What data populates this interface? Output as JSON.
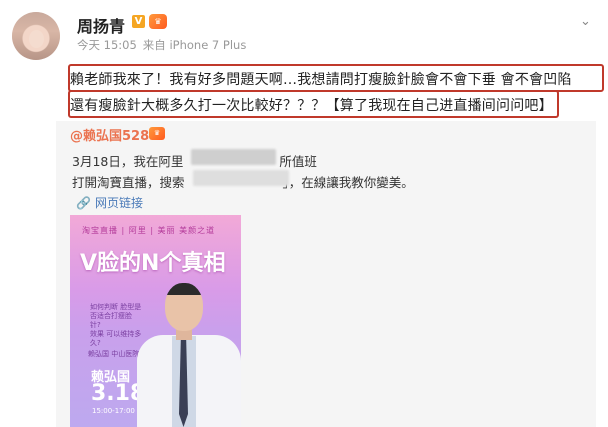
{
  "author": {
    "name": "周扬青",
    "verified_badge": "V",
    "meta_time": "今天 15:05",
    "meta_source": "来自 iPhone 7 Plus"
  },
  "post": {
    "line1": "賴老師我來了！我有好多問題天啊…我想請問打瘦臉針臉會不會下垂 會不會凹陷",
    "line2": "還有瘦臉針大概多久打一次比較好？？？【算了我现在自己进直播间问问吧】"
  },
  "repost": {
    "user": "赖弘国528",
    "user_prefix": "@",
    "line1_a": "3月18日，我在阿里",
    "line1_b": "所值班",
    "line2_a": "打開淘寶直播，搜索",
    "line2_b": "」，在線讓我教你變美。",
    "web_link": "网页链接"
  },
  "poster": {
    "logos": "淘宝直播  |  阿里  |  美丽  美颜之道",
    "title": "V脸的N个真相",
    "q1": "如何判断 脸型是否适合打瘦脸针?",
    "q2": "效果 可以维持多久?",
    "date_label": "赖弘国 中山医院",
    "name": "赖弘国",
    "date": "3.18",
    "time": "15:00-17:00"
  },
  "icons": {
    "more": "chevron-down-icon",
    "link": "link-icon"
  }
}
